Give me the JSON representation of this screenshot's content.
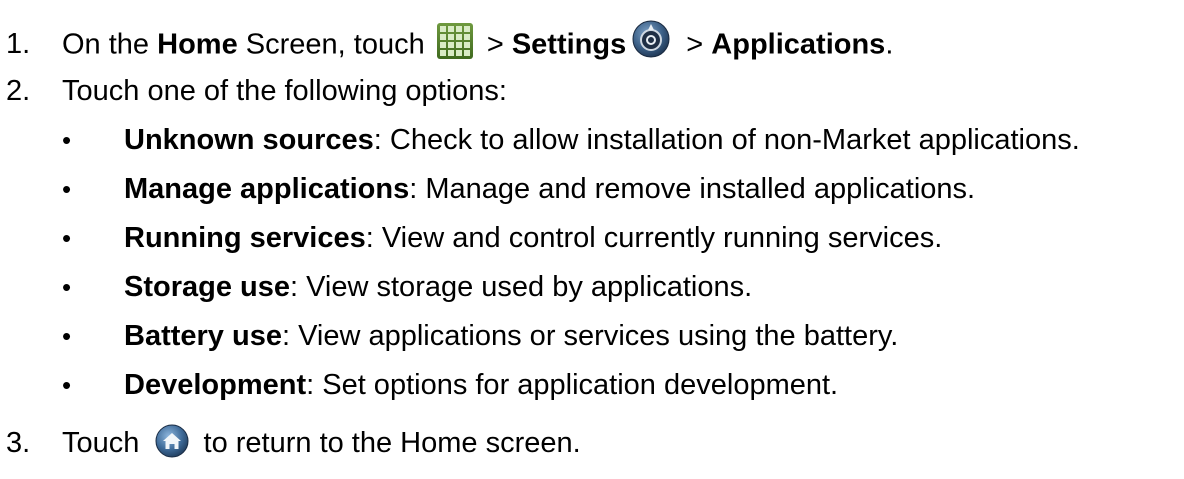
{
  "steps": [
    {
      "number": "1.",
      "parts": {
        "t1": "On the ",
        "b1": "Home",
        "t2": " Screen, touch ",
        "t3": " > ",
        "b2": "Settings",
        "t4": " > ",
        "b3": "Applications",
        "t5": "."
      }
    },
    {
      "number": "2.",
      "text": "Touch one of the following options:"
    },
    {
      "number": "3.",
      "parts": {
        "t1": "Touch ",
        "t2": " to return to the Home screen."
      }
    }
  ],
  "options": [
    {
      "name": "Unknown sources",
      "desc": ": Check to allow installation of non-Market applications."
    },
    {
      "name": "Manage applications",
      "desc": ": Manage and remove installed applications."
    },
    {
      "name": "Running services",
      "desc": ": View and control currently running services."
    },
    {
      "name": "Storage use",
      "desc": ": View storage used by applications."
    },
    {
      "name": "Battery use",
      "desc": ": View applications or services using the battery."
    },
    {
      "name": "Development",
      "desc": ": Set options for application development."
    }
  ],
  "bullet_char": "•",
  "icons": {
    "launcher": "app-grid-icon",
    "settings": "settings-icon",
    "home": "home-icon"
  }
}
